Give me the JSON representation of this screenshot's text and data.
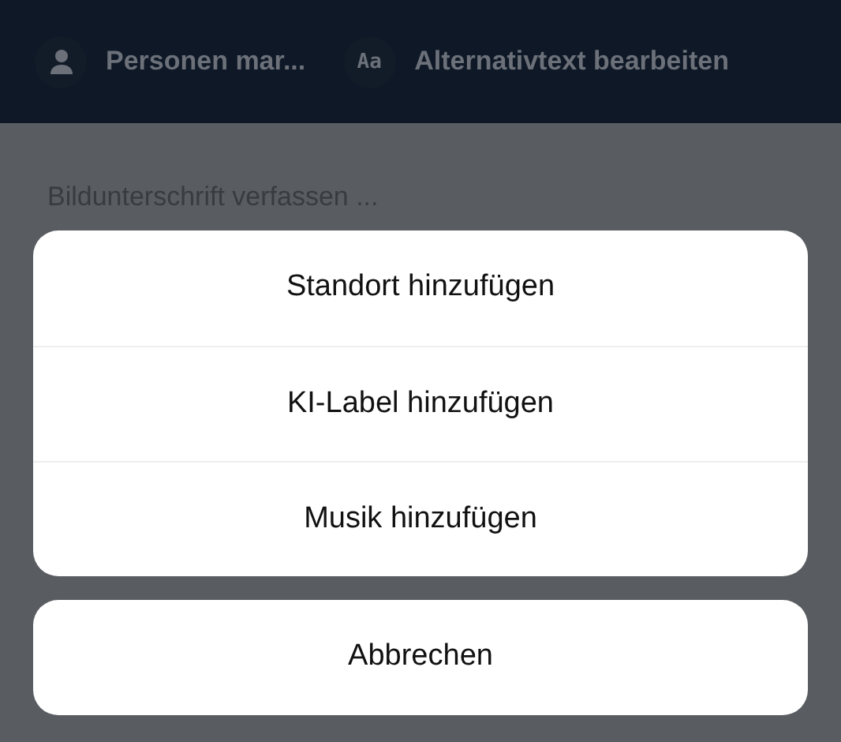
{
  "toolbar": {
    "items": [
      {
        "kind": "person",
        "label": "Personen mar..."
      },
      {
        "kind": "text",
        "icon_text": "Aa",
        "label": "Alternativtext bearbeiten"
      }
    ]
  },
  "caption": {
    "placeholder": "Bildunterschrift verfassen ..."
  },
  "action_sheet": {
    "actions": [
      "Standort hinzufügen",
      "KI-Label hinzufügen",
      "Musik hinzufügen"
    ],
    "cancel": "Abbrechen"
  }
}
